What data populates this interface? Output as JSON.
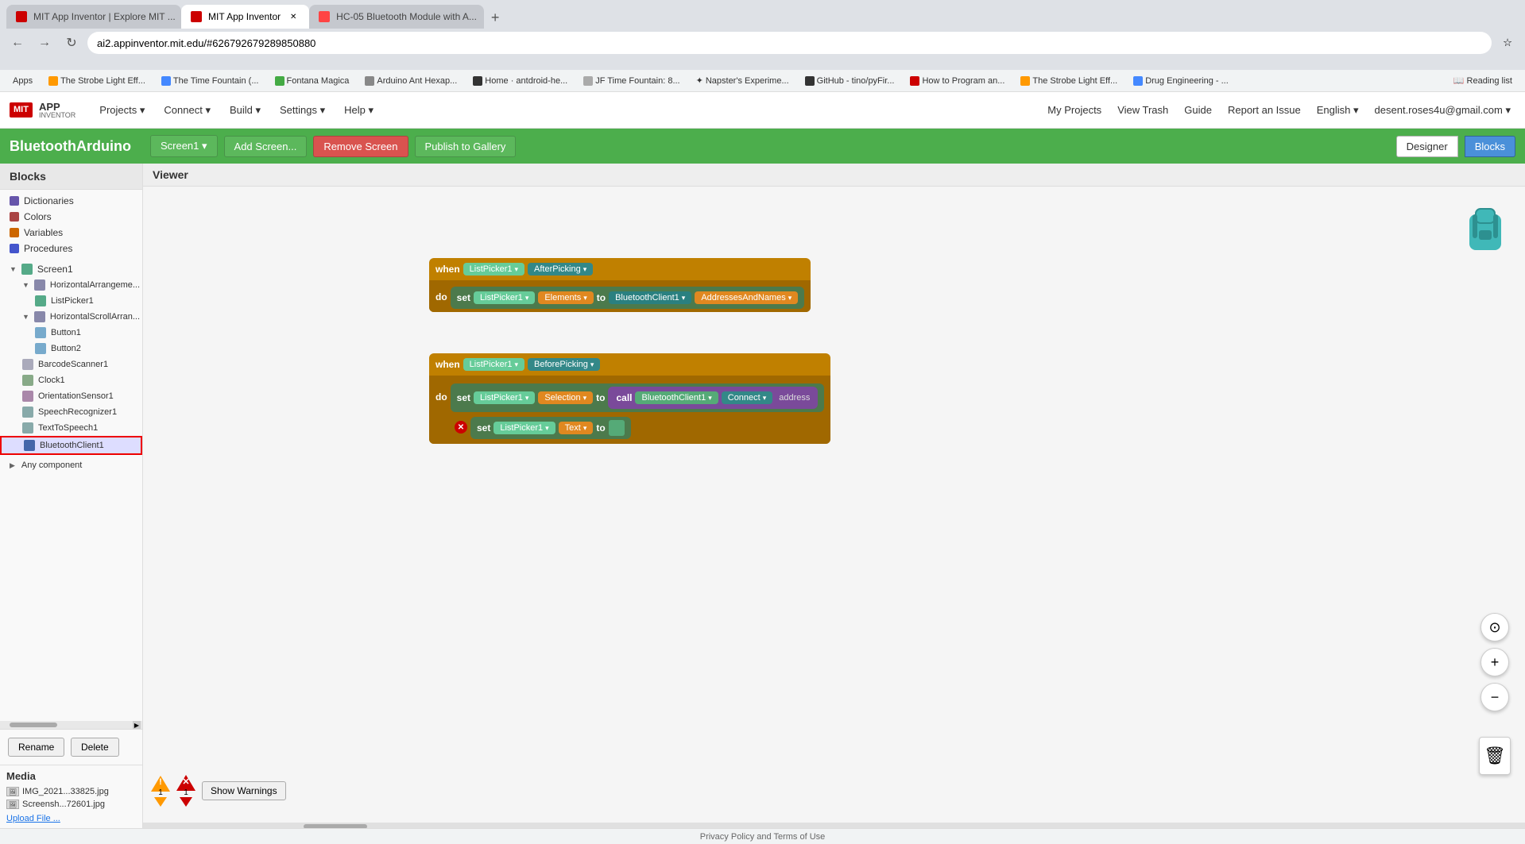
{
  "browser": {
    "tabs": [
      {
        "id": "tab1",
        "title": "MIT App Inventor | Explore MIT ...",
        "active": false,
        "favicon_color": "#c00"
      },
      {
        "id": "tab2",
        "title": "MIT App Inventor",
        "active": true,
        "favicon_color": "#c00"
      },
      {
        "id": "tab3",
        "title": "HC-05 Bluetooth Module with A...",
        "active": false,
        "favicon_color": "#f00"
      }
    ],
    "address": "ai2.appinventor.mit.edu/#626792679289850880",
    "new_tab_label": "+"
  },
  "bookmarks": [
    {
      "label": "Apps"
    },
    {
      "label": "The Strobe Light Eff..."
    },
    {
      "label": "The Time Fountain (..."
    },
    {
      "label": "Fontana Magica"
    },
    {
      "label": "Arduino Ant Hexap..."
    },
    {
      "label": "Home · antdroid-he..."
    },
    {
      "label": "JF Time Fountain: 8..."
    },
    {
      "label": "Napster's Experime..."
    },
    {
      "label": "GitHub - tino/pyFir..."
    },
    {
      "label": "How to Program an..."
    },
    {
      "label": "The Strobe Light Eff..."
    },
    {
      "label": "Drug Engineering - ..."
    },
    {
      "label": "Reading list"
    }
  ],
  "mit_header": {
    "logo_badge": "MIT",
    "logo_text": "APP",
    "logo_sub": "INVENTOR",
    "nav_items": [
      "Projects ▾",
      "Connect ▾",
      "Build ▾",
      "Settings ▾",
      "Help ▾"
    ],
    "right_items": [
      "My Projects",
      "View Trash",
      "Guide",
      "Report an Issue",
      "English ▾",
      "desent.roses4u@gmail.com ▾"
    ]
  },
  "toolbar": {
    "project_name": "BluetoothArduino",
    "screen_btn": "Screen1 ▾",
    "add_screen": "Add Screen...",
    "remove_screen": "Remove Screen",
    "publish": "Publish to Gallery",
    "designer": "Designer",
    "blocks": "Blocks"
  },
  "sidebar": {
    "header": "Blocks",
    "built_in": [
      {
        "label": "Dictionaries",
        "color": "#6655aa"
      },
      {
        "label": "Colors",
        "color": "#aa4444"
      },
      {
        "label": "Variables",
        "color": "#cc6600"
      },
      {
        "label": "Procedures",
        "color": "#4455cc"
      }
    ],
    "tree": [
      {
        "label": "Screen1",
        "indent": 0,
        "expanded": true,
        "icon": "screen"
      },
      {
        "label": "HorizontalArrangeme...",
        "indent": 1,
        "expanded": true,
        "icon": "layout"
      },
      {
        "label": "ListPicker1",
        "indent": 2,
        "icon": "listpicker"
      },
      {
        "label": "HorizontalScrollArran...",
        "indent": 1,
        "expanded": true,
        "icon": "layout"
      },
      {
        "label": "Button1",
        "indent": 2,
        "icon": "button"
      },
      {
        "label": "Button2",
        "indent": 2,
        "icon": "button"
      },
      {
        "label": "BarcodeScanner1",
        "indent": 1,
        "icon": "barcode"
      },
      {
        "label": "Clock1",
        "indent": 1,
        "icon": "clock"
      },
      {
        "label": "OrientationSensor1",
        "indent": 1,
        "icon": "sensor"
      },
      {
        "label": "SpeechRecognizer1",
        "indent": 1,
        "icon": "speech"
      },
      {
        "label": "TextToSpeech1",
        "indent": 1,
        "icon": "speech"
      },
      {
        "label": "BluetoothClient1",
        "indent": 1,
        "icon": "bluetooth",
        "selected": true
      }
    ],
    "any_component": "Any component",
    "rename_btn": "Rename",
    "delete_btn": "Delete"
  },
  "media": {
    "header": "Media",
    "files": [
      "IMG_2021...33825.jpg",
      "Screensh...72601.jpg"
    ],
    "upload_btn": "Upload File ..."
  },
  "viewer": {
    "header": "Viewer"
  },
  "blocks": {
    "block1": {
      "when_label": "when",
      "component": "ListPicker1",
      "event": "AfterPicking",
      "do_label": "do",
      "set_label": "set",
      "set_component": "ListPicker1",
      "set_prop": "Elements",
      "to_label": "to",
      "value_component": "BluetoothClient1",
      "value_prop": "AddressesAndNames"
    },
    "block2": {
      "when_label": "when",
      "component": "ListPicker1",
      "event": "BeforePicking",
      "do_label": "do",
      "set_label": "set",
      "set_component": "ListPicker1",
      "set_prop": "Selection",
      "to_label": "to",
      "call_label": "call",
      "call_component": "BluetoothClient1",
      "call_method": "Connect",
      "call_param": "address",
      "set2_label": "set",
      "set2_component": "ListPicker1",
      "set2_prop": "Text",
      "to2_label": "to"
    }
  },
  "warnings": {
    "warning_count": "1",
    "error_count": "1",
    "show_btn": "Show Warnings"
  },
  "status_bar": {
    "text": "Privacy Policy and Terms of Use"
  },
  "icons": {
    "back": "←",
    "forward": "→",
    "refresh": "↻",
    "home": "⌂",
    "star": "☆",
    "target": "⊙",
    "plus_circle": "+",
    "minus_circle": "−",
    "trash": "🗑",
    "expand": "▶",
    "collapse": "▼",
    "chevron_down": "▾"
  }
}
